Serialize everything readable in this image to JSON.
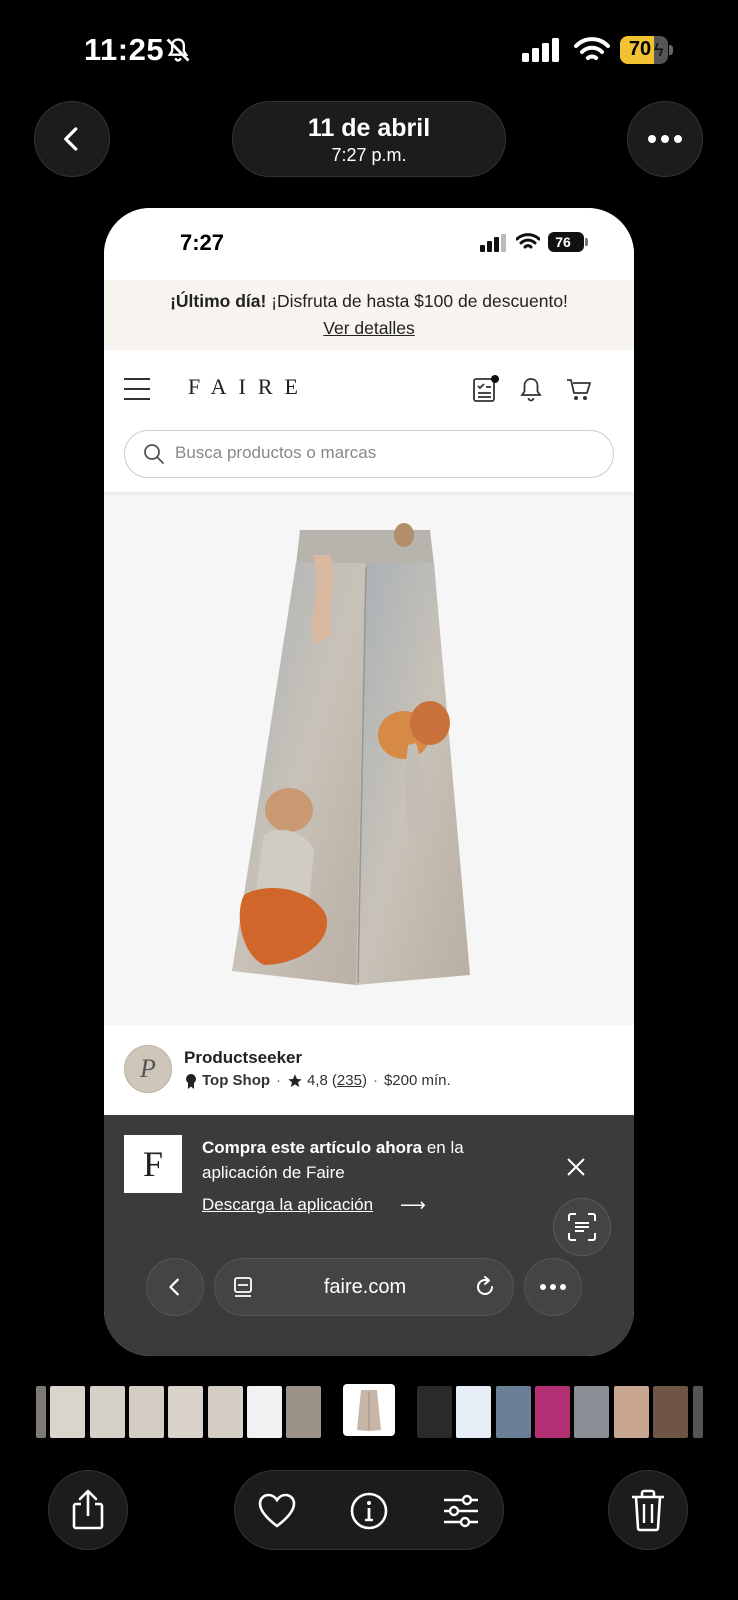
{
  "os_status": {
    "time": "11:25",
    "battery": "70"
  },
  "header": {
    "date": "11 de abril",
    "time": "7:27 p.m."
  },
  "screenshot": {
    "status": {
      "time": "7:27",
      "battery": "76"
    },
    "promo": {
      "bold": "¡Último día!",
      "text": " ¡Disfruta de hasta $100 de descuento!",
      "link": "Ver detalles"
    },
    "nav": {
      "logo": "FAIRE"
    },
    "search": {
      "placeholder": "Busca productos o marcas"
    },
    "seller": {
      "avatar_letter": "P",
      "name": "Productseeker",
      "badge": "Top Shop",
      "rating": "4,8",
      "reviews": "235",
      "minimum": "$200 mín."
    },
    "app_banner": {
      "logo_letter": "F",
      "bold": "Compra este artículo ahora",
      "text": " en la aplicación de Faire",
      "link": "Descarga la aplicación"
    },
    "browser": {
      "url": "faire.com"
    }
  },
  "colors": {
    "accent_battery": "#f2c230",
    "banner_bg": "#3b3b3b",
    "promo_bg": "#f8f4ef"
  }
}
